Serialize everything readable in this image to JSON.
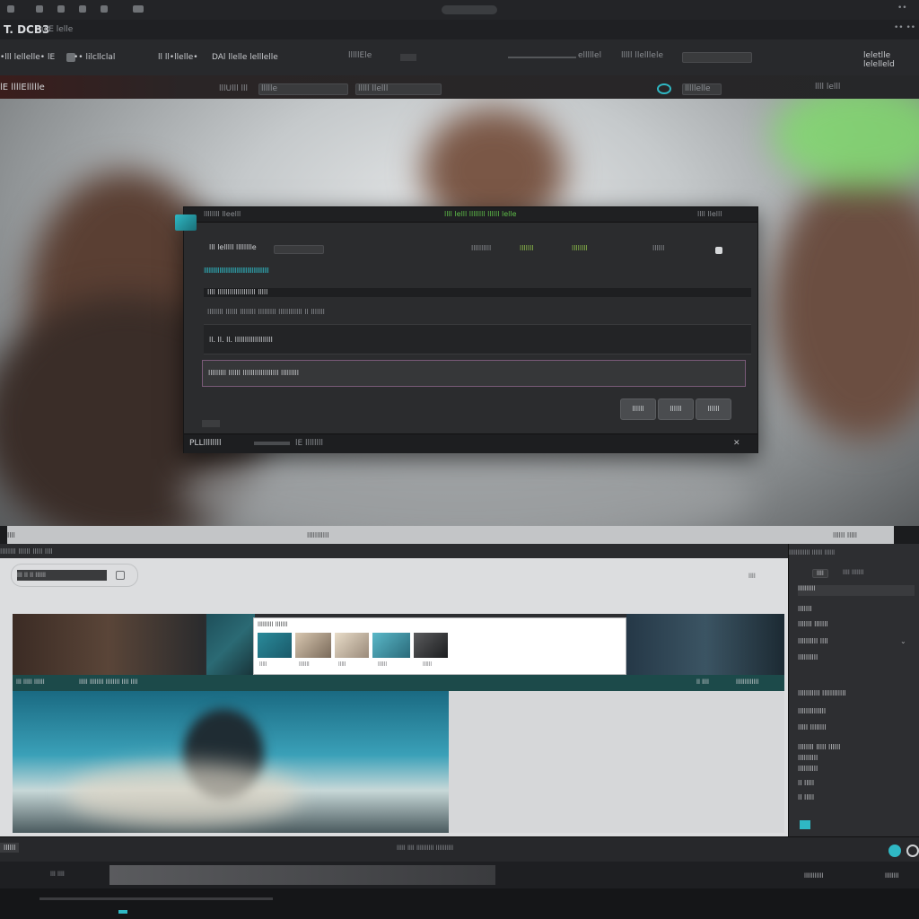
{
  "topbar": {
    "left_items": [
      "•",
      "•",
      "•"
    ],
    "center_pill": "",
    "right_text": "••"
  },
  "titlebar": {
    "title": "T. DCB3",
    "subtitle": "ulE lelle",
    "right": "•• ••"
  },
  "toolbar": {
    "item1": "•lll lellelle• lE",
    "item2": "•• lilcllclal",
    "item3": "ll ll•llelle•",
    "item4": "DAl llelle lelllelle",
    "item5": "lllllEle",
    "item6": "elllllel",
    "item7": "lllll llelllele",
    "item8": "leletlle lelelleld"
  },
  "subbar": {
    "project": "lE llllEllllle",
    "label1": "lllUlll lll",
    "field1": "llllle",
    "field2": "lllll llelll",
    "search": "lllllelle",
    "right": "llll lelll"
  },
  "dialog": {
    "title_left": "llllllll lleelll",
    "title_center": "llll lelll  llllllll llllll lelle",
    "title_right": "llll llelll",
    "label1": "lll lelllll lllllllle",
    "accent_line": "llllllllllllllllllllllllllllllllllllllllll",
    "row1": "llll lllllllllllllllllll lllll",
    "row2": "llllllll llllll llllllll lllllllll llllllllllll ll lllllll",
    "row3": "ll. ll. ll. lllllllllllllllllll",
    "input_text": "lllllllll llllll llllllllllllllllll lllllllll",
    "chip1": "llllllllll",
    "chip2": "lllllll",
    "chip3": "llllllll",
    "chip4": "llllll",
    "btn1": "llllll",
    "btn2": "llllll",
    "btn3": "llllll",
    "footer": "PLLllllllll",
    "footer2": "lE llllllll"
  },
  "strip": {
    "left": "llll",
    "center": "lllllllllll",
    "right": "llllll lllll"
  },
  "lower": {
    "header": "llllllll llllll  lllll llll",
    "search_placeholder": "lll ll ll llllll",
    "ruler": "llll",
    "popup_title": "lllllllll lllllll",
    "thumbs": [
      "lllll",
      "lllllll",
      "lllll",
      "llllll",
      "llllll"
    ],
    "caption_left": "lll lllll  llllll",
    "caption_mid": "lllll llllllll llllllll llll llll",
    "caption_right1": "ll llll",
    "caption_right2": "lllllllllllll"
  },
  "rightpanel": {
    "header": "llllllllllll  llllll  llllll",
    "tab1": "llll",
    "tab2": "llll lllllll",
    "subheader": "llllllllll",
    "items": [
      "lllllll",
      "lllllll lllllll",
      "llllllllll llll",
      "llllllllll",
      "lllllllllll llllllllllll",
      "llllllllllllll",
      "lllll llllllll",
      "llllllll lllll llllll",
      "llllllllll",
      "llllllllll",
      "ll lllll",
      "ll lllll"
    ]
  },
  "bottom": {
    "left": "llllll",
    "center": "lllll llll  llllllllll llllllllll",
    "tab": "lll llll",
    "right1": "lllllllllll",
    "right2": "llllllll"
  },
  "colors": {
    "accent": "#2fb8c4",
    "accent_green": "#5fbf4a",
    "dialog_bg": "#2b2c2e",
    "footer_teal": "#1c4a4a"
  }
}
